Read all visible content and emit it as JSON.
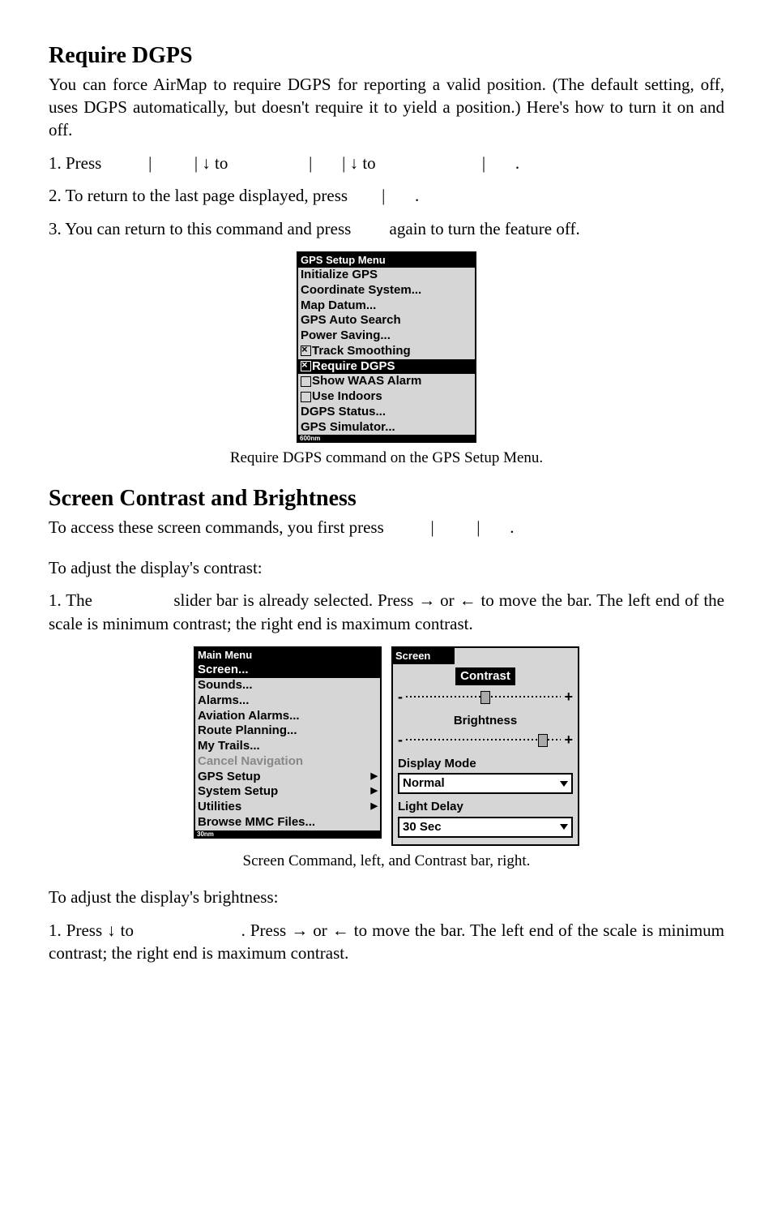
{
  "section1": {
    "heading": "Require DGPS",
    "intro": "You can force AirMap to require DGPS for reporting a valid position. (The default setting, off, uses DGPS automatically, but doesn't require it to yield a position.) Here's how to turn it on and off.",
    "step1_a": "1. Press ",
    "pipe": "|",
    "arrow_down": "↓",
    "to": " to ",
    "dot": ".",
    "step2": "2. To return to the last page displayed, press ",
    "step3_a": "3. You can return to this command and press ",
    "step3_b": " again to turn the feature off."
  },
  "gps_menu": {
    "title": "GPS Setup Menu",
    "items": [
      "Initialize GPS",
      "Coordinate System...",
      "Map Datum...",
      "GPS Auto Search",
      "Power Saving...",
      "Track Smoothing",
      "Require DGPS",
      "Show WAAS Alarm",
      "Use Indoors",
      "DGPS Status...",
      "GPS Simulator..."
    ],
    "footer": "600nm"
  },
  "caption1": "Require DGPS command on the GPS Setup Menu.",
  "section2": {
    "heading": "Screen Contrast and Brightness",
    "intro": "To access these screen commands, you first press ",
    "contrast_heading": "To adjust the display's contrast:",
    "contrast_step_a": "1. The ",
    "contrast_step_b": " slider bar is already selected. Press → or ← to move the bar. The left end of the scale is minimum contrast; the right end is maximum contrast."
  },
  "main_menu": {
    "title": "Main Menu",
    "items": [
      "Screen...",
      "Sounds...",
      "Alarms...",
      "Aviation Alarms...",
      "Route Planning...",
      "My Trails...",
      "Cancel Navigation",
      "GPS Setup",
      "System Setup",
      "Utilities",
      "Browse MMC Files..."
    ],
    "footer": "30nm"
  },
  "screen_panel": {
    "title": "Screen",
    "contrast_label": "Contrast",
    "brightness_label": "Brightness",
    "display_mode_label": "Display Mode",
    "display_mode_value": "Normal",
    "light_delay_label": "Light Delay",
    "light_delay_value": "30 Sec"
  },
  "caption2": "Screen Command, left, and Contrast bar, right.",
  "section3": {
    "heading": "To adjust the display's brightness:",
    "step_a": "1. Press ↓ to ",
    "step_b": ". Press → or ← to move the bar. The left end of the scale is minimum contrast; the right end is maximum contrast."
  }
}
